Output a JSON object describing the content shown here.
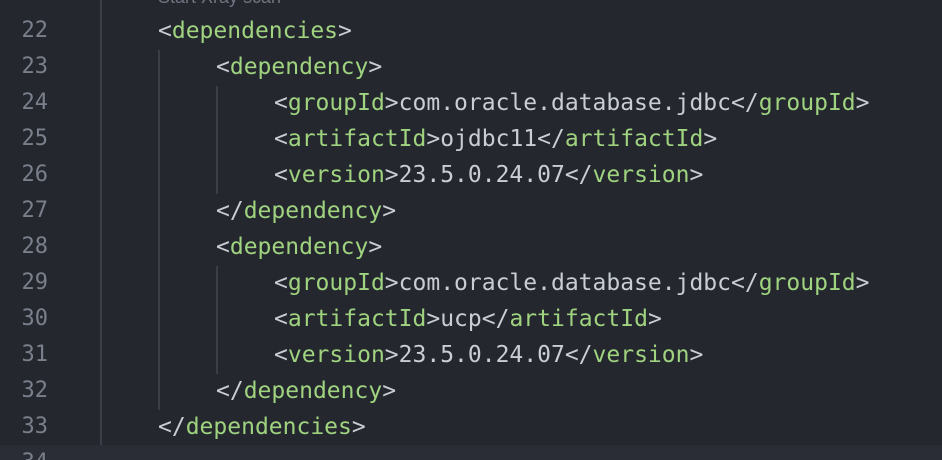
{
  "hint_text": "Start Xray scan",
  "lines": [
    {
      "num": "22",
      "open": "<",
      "tag": "dependencies",
      "close": ">",
      "value": "",
      "end_open": "",
      "end_tag": "",
      "end_close": ""
    },
    {
      "num": "23",
      "open": "<",
      "tag": "dependency",
      "close": ">",
      "value": "",
      "end_open": "",
      "end_tag": "",
      "end_close": ""
    },
    {
      "num": "24",
      "open": "<",
      "tag": "groupId",
      "close": ">",
      "value": "com.oracle.database.jdbc",
      "end_open": "</",
      "end_tag": "groupId",
      "end_close": ">"
    },
    {
      "num": "25",
      "open": "<",
      "tag": "artifactId",
      "close": ">",
      "value": "ojdbc11",
      "end_open": "</",
      "end_tag": "artifactId",
      "end_close": ">"
    },
    {
      "num": "26",
      "open": "<",
      "tag": "version",
      "close": ">",
      "value": "23.5.0.24.07",
      "end_open": "</",
      "end_tag": "version",
      "end_close": ">"
    },
    {
      "num": "27",
      "open": "</",
      "tag": "dependency",
      "close": ">",
      "value": "",
      "end_open": "",
      "end_tag": "",
      "end_close": ""
    },
    {
      "num": "28",
      "open": "<",
      "tag": "dependency",
      "close": ">",
      "value": "",
      "end_open": "",
      "end_tag": "",
      "end_close": ""
    },
    {
      "num": "29",
      "open": "<",
      "tag": "groupId",
      "close": ">",
      "value": "com.oracle.database.jdbc",
      "end_open": "</",
      "end_tag": "groupId",
      "end_close": ">"
    },
    {
      "num": "30",
      "open": "<",
      "tag": "artifactId",
      "close": ">",
      "value": "ucp",
      "end_open": "</",
      "end_tag": "artifactId",
      "end_close": ">"
    },
    {
      "num": "31",
      "open": "<",
      "tag": "version",
      "close": ">",
      "value": "23.5.0.24.07",
      "end_open": "</",
      "end_tag": "version",
      "end_close": ">"
    },
    {
      "num": "32",
      "open": "</",
      "tag": "dependency",
      "close": ">",
      "value": "",
      "end_open": "",
      "end_tag": "",
      "end_close": ""
    },
    {
      "num": "33",
      "open": "</",
      "tag": "dependencies",
      "close": ">",
      "value": "",
      "end_open": "",
      "end_tag": "",
      "end_close": ""
    },
    {
      "num": "34",
      "open": "",
      "tag": "",
      "close": "",
      "value": "",
      "end_open": "",
      "end_tag": "",
      "end_close": ""
    }
  ],
  "colors": {
    "background": "#24272e",
    "tag": "#9fd37f",
    "text": "#c9cdd4",
    "line_number": "#7a808b",
    "indent_guide": "#3a3e47"
  }
}
